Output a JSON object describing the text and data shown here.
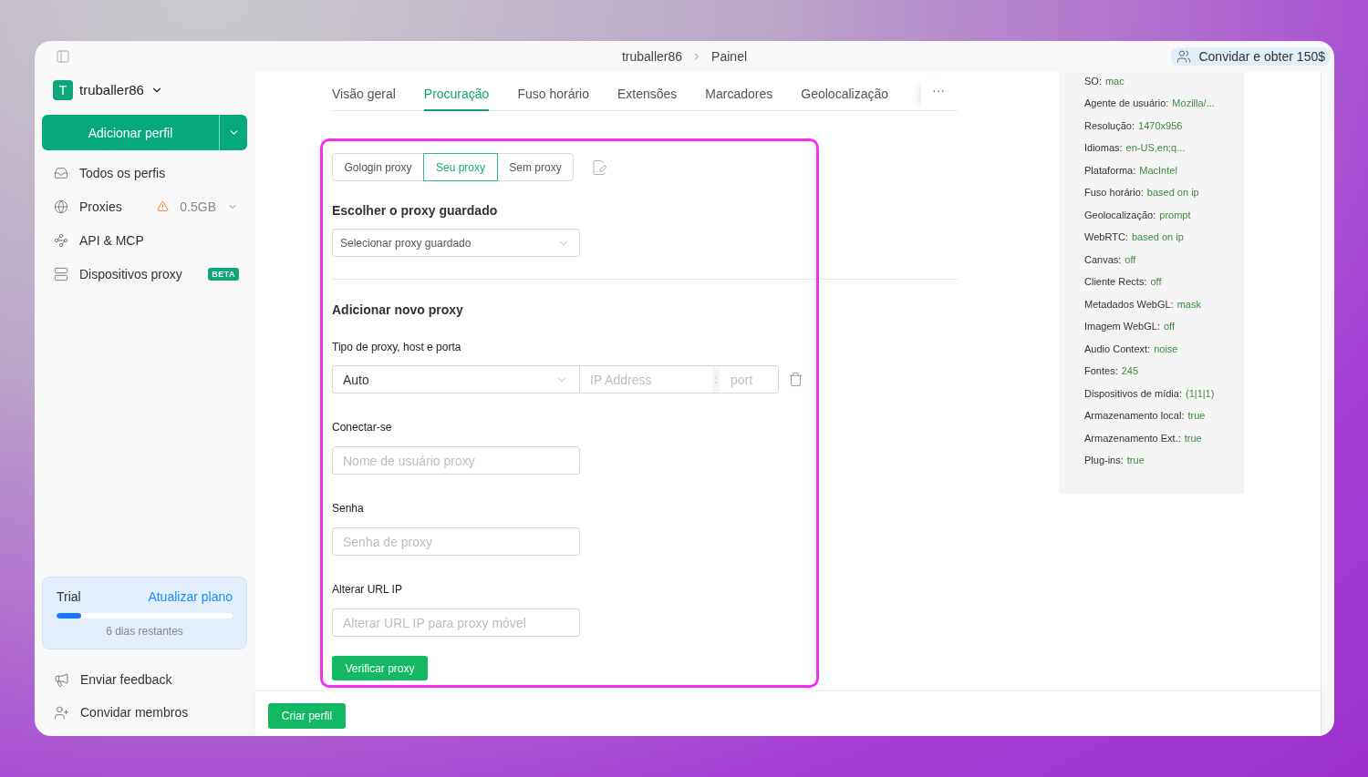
{
  "title_bar": {
    "breadcrumb": [
      "truballer86",
      "Painel"
    ],
    "invite_button": "Convidar e obter 150$"
  },
  "sidebar": {
    "workspace": {
      "avatar": "T",
      "name": "truballer86"
    },
    "add_profile_button": "Adicionar perfil",
    "nav_items": [
      {
        "label": "Todos os perfis",
        "selected": false
      },
      {
        "label": "Proxies",
        "selected": false,
        "warning": true,
        "traffic": "0.5GB"
      },
      {
        "label": "API & MCP",
        "selected": false
      },
      {
        "label": "Dispositivos proxy",
        "selected": false,
        "badge": "BETA"
      }
    ],
    "trial": {
      "plan": "Trial",
      "upgrade_link": "Atualizar plano",
      "level": 0.14,
      "remaining": "6 dias restantes"
    },
    "bottom_items": [
      {
        "label": "Enviar feedback"
      },
      {
        "label": "Convidar membros"
      }
    ]
  },
  "tabs": {
    "items": [
      {
        "label": "Visão geral",
        "selected": false
      },
      {
        "label": "Procuração",
        "selected": true
      },
      {
        "label": "Fuso horário",
        "selected": false
      },
      {
        "label": "Extensões",
        "selected": false
      },
      {
        "label": "Marcadores",
        "selected": false
      },
      {
        "label": "Geolocalização",
        "selected": false
      }
    ],
    "more_button": "···"
  },
  "proxy_form": {
    "highlighted": true,
    "modes": [
      {
        "label": "Gologin proxy",
        "selected": false
      },
      {
        "label": "Seu proxy",
        "selected": true
      },
      {
        "label": "Sem proxy",
        "selected": false
      }
    ],
    "saved_heading": "Escolher o proxy guardado",
    "saved_select": {
      "placeholder": "Selecionar proxy guardado"
    },
    "new_heading": "Adicionar novo proxy",
    "host_label": "Tipo de proxy, host e porta",
    "type_select": {
      "value": "Auto"
    },
    "host_field": {
      "placeholder": "IP Address"
    },
    "separator": ":",
    "port_field": {
      "placeholder": "port"
    },
    "fields": [
      {
        "label": "Conectar-se",
        "placeholder": "Nome de usuário proxy"
      },
      {
        "label": "Senha",
        "placeholder": "Senha de proxy"
      },
      {
        "label": "Alterar URL IP",
        "placeholder": "Alterar URL IP para proxy móvel"
      }
    ],
    "check_button": "Verificar proxy"
  },
  "fingerprint": [
    {
      "label": "SO:",
      "value": "mac"
    },
    {
      "label": "Agente de usuário:",
      "value": "Mozilla/..."
    },
    {
      "label": "Resolução:",
      "value": "1470x956"
    },
    {
      "label": "Idiomas:",
      "value": "en-US,en;q..."
    },
    {
      "label": "Plataforma:",
      "value": "MacIntel"
    },
    {
      "label": "Fuso horário:",
      "value": "based on ip"
    },
    {
      "label": "Geolocalização:",
      "value": "prompt"
    },
    {
      "label": "WebRTC:",
      "value": "based on ip"
    },
    {
      "label": "Canvas:",
      "value": "off"
    },
    {
      "label": "Cliente Rects:",
      "value": "off"
    },
    {
      "label": "Metadados WebGL:",
      "value": "mask"
    },
    {
      "label": "Imagem WebGL:",
      "value": "off"
    },
    {
      "label": "Audio Context:",
      "value": "noise"
    },
    {
      "label": "Fontes:",
      "value": "245"
    },
    {
      "label": "Dispositivos de mídia:",
      "value": "(1|1|1)"
    },
    {
      "label": "Armazenamento local:",
      "value": "true"
    },
    {
      "label": "Armazenamento Ext.:",
      "value": "true"
    },
    {
      "label": "Plug-ins:",
      "value": "true"
    }
  ],
  "footer": {
    "create_button": "Criar perfil"
  }
}
